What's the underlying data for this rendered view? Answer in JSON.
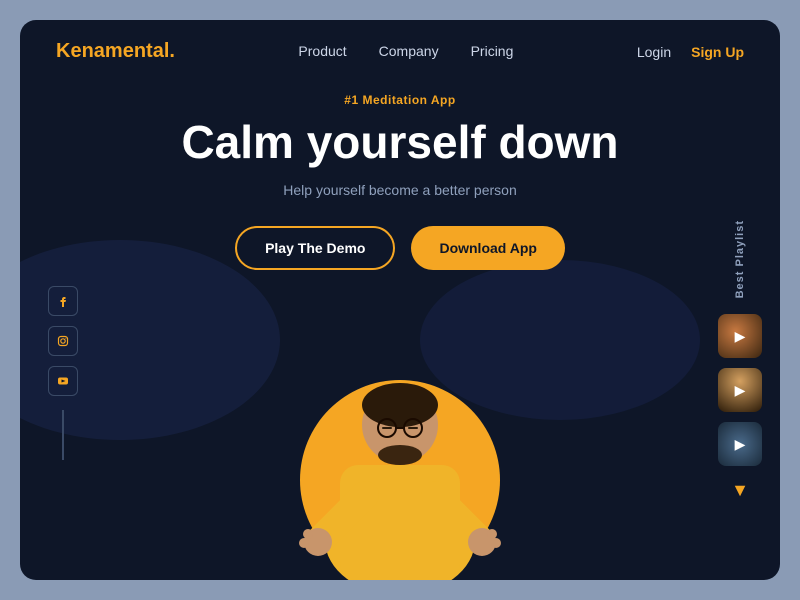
{
  "logo": {
    "prefix": "Kena",
    "suffix": "mental",
    "dot": "."
  },
  "nav": {
    "links": [
      {
        "label": "Product",
        "id": "product"
      },
      {
        "label": "Company",
        "id": "company"
      },
      {
        "label": "Pricing",
        "id": "pricing"
      }
    ],
    "login": "Login",
    "signup": "Sign Up"
  },
  "hero": {
    "tag": "#1 Meditation App",
    "title": "Calm yourself down",
    "subtitle": "Help yourself become a better person",
    "btn_demo": "Play The Demo",
    "btn_download": "Download App"
  },
  "social": {
    "icons": [
      {
        "name": "facebook",
        "symbol": "f"
      },
      {
        "name": "instagram",
        "symbol": "◎"
      },
      {
        "name": "youtube",
        "symbol": "▶"
      }
    ]
  },
  "playlist": {
    "label": "Best Playlist",
    "items": [
      {
        "id": 1,
        "class": "playlist-item-1"
      },
      {
        "id": 2,
        "class": "playlist-item-2"
      },
      {
        "id": 3,
        "class": "playlist-item-3"
      }
    ]
  }
}
